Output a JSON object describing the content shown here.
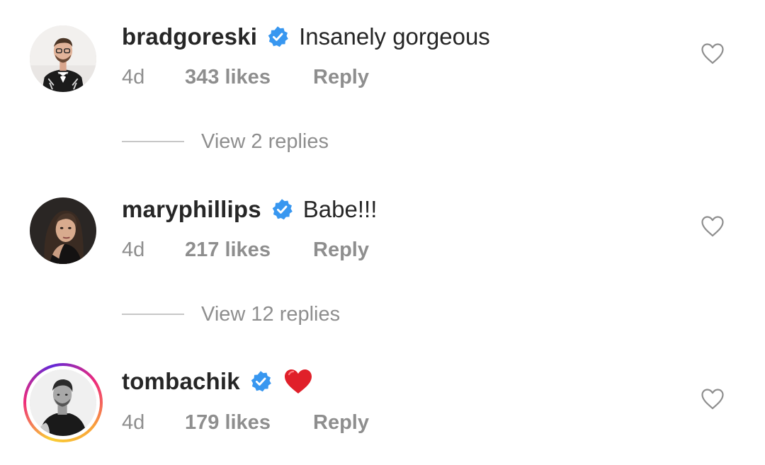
{
  "comments": [
    {
      "username": "bradgoreski",
      "verified": true,
      "text": "Insanely gorgeous",
      "time": "4d",
      "likes": "343 likes",
      "reply": "Reply",
      "view_replies": "View 2 replies"
    },
    {
      "username": "maryphillips",
      "verified": true,
      "text": "Babe!!!",
      "time": "4d",
      "likes": "217 likes",
      "reply": "Reply",
      "view_replies": "View 12 replies"
    },
    {
      "username": "tombachik",
      "verified": true,
      "text": "",
      "emoji": "red-heart",
      "time": "4d",
      "likes": "179 likes",
      "reply": "Reply",
      "has_story": true
    }
  ],
  "colors": {
    "verified_blue": "#3897f0",
    "meta_gray": "#8e8e8e",
    "text_dark": "#262626",
    "emoji_red": "#e0202a"
  }
}
